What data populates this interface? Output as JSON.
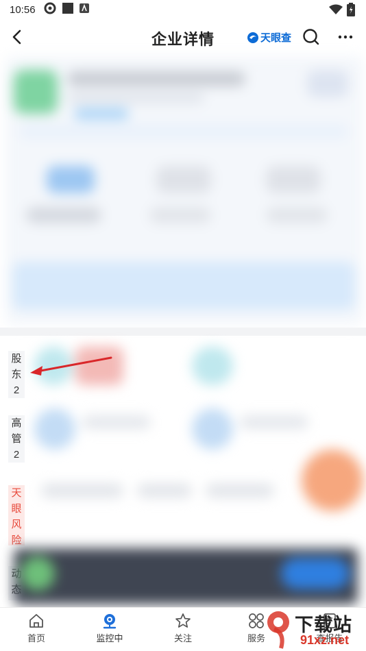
{
  "status_bar": {
    "time": "10:56"
  },
  "header": {
    "title": "企业详情",
    "brand_name": "天眼查"
  },
  "side_tabs": [
    {
      "label": "股东",
      "count": "2",
      "color": "#333333"
    },
    {
      "label": "高管",
      "count": "2",
      "color": "#333333"
    },
    {
      "label": "天眼风险",
      "count": "",
      "color": "#e84a3c"
    },
    {
      "label": "动态",
      "count": "",
      "color": "#333333"
    }
  ],
  "bottom_nav": {
    "items": [
      {
        "label": "首页",
        "icon": "home-icon"
      },
      {
        "label": "监控中",
        "icon": "monitor-camera-icon"
      },
      {
        "label": "关注",
        "icon": "star-icon"
      },
      {
        "label": "服务",
        "icon": "services-grid-icon"
      },
      {
        "label": "查报告",
        "icon": "report-icon"
      }
    ]
  },
  "watermark": {
    "text_top": "下载站",
    "text_bottom": "91xz.net"
  },
  "colors": {
    "brand": "#0d6bd6",
    "risk": "#e84a3c",
    "arrow": "#d9272a"
  }
}
